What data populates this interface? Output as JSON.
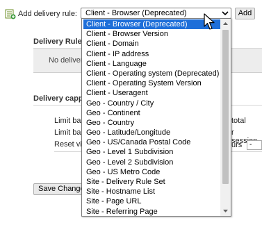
{
  "rule_row": {
    "label": "Add delivery rule:",
    "selected_value": "Client - Browser (Deprecated)",
    "add_button": "Add"
  },
  "background": {
    "delivery_rules_header": "Delivery Rule",
    "no_rules_text": "No deliver",
    "capping_header": "Delivery capp",
    "limit_1": "Limit ba",
    "limit_1_suffix": "total",
    "limit_2": "Limit ba",
    "limit_2_suffix": "r session",
    "reset_label": "Reset vi",
    "reset_suffix": "urs",
    "reset_input_value": "-",
    "save_button": "Save Change"
  },
  "dropdown": {
    "options": [
      "Client - Browser (Deprecated)",
      "Client - Browser Version",
      "Client - Domain",
      "Client - IP address",
      "Client - Language",
      "Client - Operating system (Deprecated)",
      "Client - Operating System Version",
      "Client - Useragent",
      "Geo - Country / City",
      "Geo - Continent",
      "Geo - Country",
      "Geo - Latitude/Longitude",
      "Geo - US/Canada Postal Code",
      "Geo - Level 1 Subdivision",
      "Geo - Level 2 Subdivision",
      "Geo - US Metro Code",
      "Site - Delivery Rule Set",
      "Site - Hostname List",
      "Site - Page URL",
      "Site - Referring Page"
    ],
    "selected_index": 0
  },
  "icons": {
    "rule": "add-rule-icon",
    "select_arrow": "chevron-down-icon",
    "scroll_up": "scroll-up-arrow-icon",
    "scroll_down": "scroll-down-arrow-icon",
    "cursor": "mouse-pointer-icon"
  },
  "colors": {
    "selection": "#1e6fd9",
    "page_background": "#ffffff"
  }
}
